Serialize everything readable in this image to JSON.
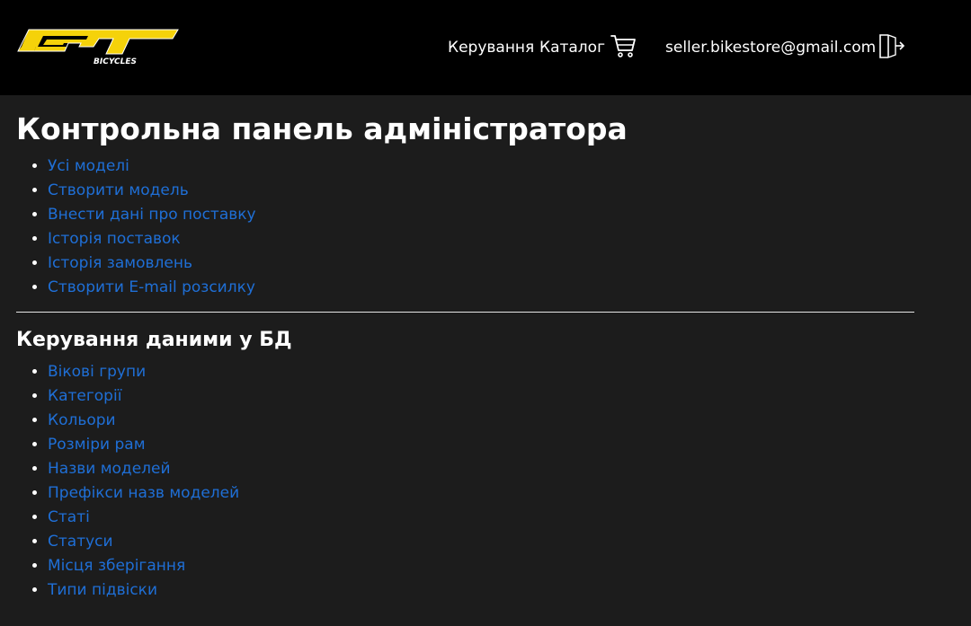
{
  "header": {
    "logo_text": "GT",
    "logo_subtext": "BICYCLES",
    "nav": [
      {
        "label": "Керування"
      },
      {
        "label": "Каталог"
      }
    ],
    "cart_icon": "cart-icon",
    "user_email": "seller.bikestore@gmail.com",
    "logout_icon": "logout-icon"
  },
  "main": {
    "title": "Контрольна панель адміністратора",
    "admin_links": [
      {
        "label": "Усі моделі"
      },
      {
        "label": "Створити модель"
      },
      {
        "label": "Внести дані про поставку"
      },
      {
        "label": "Історія поставок"
      },
      {
        "label": "Історія замовлень"
      },
      {
        "label": "Створити E-mail розсилку"
      }
    ],
    "db_section_title": "Керування даними у БД",
    "db_links": [
      {
        "label": "Вікові групи"
      },
      {
        "label": "Категорії"
      },
      {
        "label": "Кольори"
      },
      {
        "label": "Розміри рам"
      },
      {
        "label": "Назви моделей"
      },
      {
        "label": "Префікси назв моделей"
      },
      {
        "label": "Статі"
      },
      {
        "label": "Статуси"
      },
      {
        "label": "Місця зберігання"
      },
      {
        "label": "Типи підвіски"
      }
    ]
  },
  "colors": {
    "header_bg": "#000000",
    "page_bg": "#1c1c1c",
    "link": "#1f6fd6",
    "logo_yellow": "#f5d20a",
    "text": "#ffffff"
  }
}
